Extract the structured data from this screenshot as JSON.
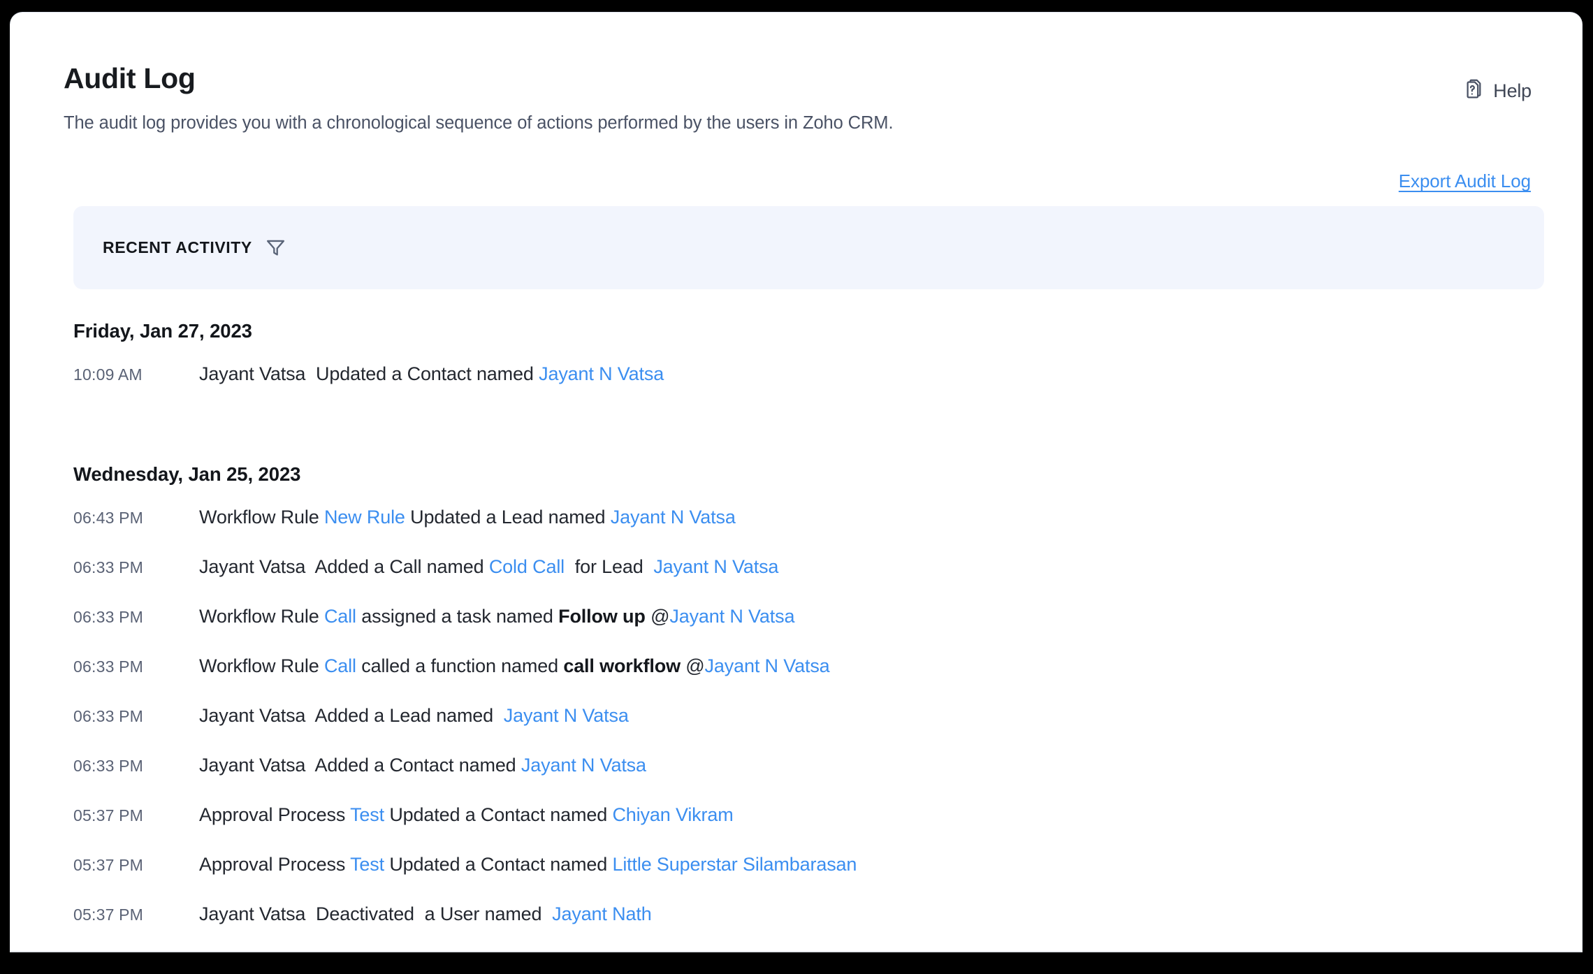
{
  "header": {
    "title": "Audit Log",
    "description": "The audit log provides you with a chronological sequence of actions performed by the users in Zoho CRM.",
    "help_label": "Help",
    "help_icon": "help-document-icon",
    "export_label": "Export Audit Log"
  },
  "toolbar": {
    "recent_activity_label": "RECENT ACTIVITY",
    "filter_icon": "filter-funnel-icon"
  },
  "colors": {
    "link": "#3b8ef0",
    "panel_background": "#f2f5fd",
    "text": "#23272f",
    "muted_text": "#5a6275"
  },
  "groups": [
    {
      "date": "Friday, Jan 27, 2023",
      "entries": [
        {
          "time": "10:09 AM",
          "parts": [
            {
              "t": "Jayant Vatsa  Updated a Contact named ",
              "s": "plain"
            },
            {
              "t": "Jayant N Vatsa",
              "s": "link"
            }
          ]
        }
      ]
    },
    {
      "date": "Wednesday, Jan 25, 2023",
      "entries": [
        {
          "time": "06:43 PM",
          "parts": [
            {
              "t": "Workflow Rule ",
              "s": "plain"
            },
            {
              "t": "New Rule",
              "s": "link"
            },
            {
              "t": " Updated a Lead named ",
              "s": "plain"
            },
            {
              "t": "Jayant N Vatsa",
              "s": "link"
            }
          ]
        },
        {
          "time": "06:33 PM",
          "parts": [
            {
              "t": "Jayant Vatsa  Added a Call named ",
              "s": "plain"
            },
            {
              "t": "Cold Call",
              "s": "link"
            },
            {
              "t": "  for Lead  ",
              "s": "plain"
            },
            {
              "t": "Jayant N Vatsa",
              "s": "link"
            }
          ]
        },
        {
          "time": "06:33 PM",
          "parts": [
            {
              "t": "Workflow Rule ",
              "s": "plain"
            },
            {
              "t": "Call",
              "s": "link"
            },
            {
              "t": " assigned a task named ",
              "s": "plain"
            },
            {
              "t": "Follow up",
              "s": "bold"
            },
            {
              "t": " @",
              "s": "plain"
            },
            {
              "t": "Jayant N Vatsa",
              "s": "link"
            }
          ]
        },
        {
          "time": "06:33 PM",
          "parts": [
            {
              "t": "Workflow Rule ",
              "s": "plain"
            },
            {
              "t": "Call",
              "s": "link"
            },
            {
              "t": " called a function named ",
              "s": "plain"
            },
            {
              "t": "call workflow",
              "s": "bold"
            },
            {
              "t": " @",
              "s": "plain"
            },
            {
              "t": "Jayant N Vatsa",
              "s": "link"
            }
          ]
        },
        {
          "time": "06:33 PM",
          "parts": [
            {
              "t": "Jayant Vatsa  Added a Lead named  ",
              "s": "plain"
            },
            {
              "t": "Jayant N Vatsa",
              "s": "link"
            }
          ]
        },
        {
          "time": "06:33 PM",
          "parts": [
            {
              "t": "Jayant Vatsa  Added a Contact named ",
              "s": "plain"
            },
            {
              "t": "Jayant N Vatsa",
              "s": "link"
            }
          ]
        },
        {
          "time": "05:37 PM",
          "parts": [
            {
              "t": "Approval Process ",
              "s": "plain"
            },
            {
              "t": "Test",
              "s": "link"
            },
            {
              "t": " Updated a Contact named ",
              "s": "plain"
            },
            {
              "t": "Chiyan Vikram",
              "s": "link"
            }
          ]
        },
        {
          "time": "05:37 PM",
          "parts": [
            {
              "t": "Approval Process ",
              "s": "plain"
            },
            {
              "t": "Test",
              "s": "link"
            },
            {
              "t": " Updated a Contact named ",
              "s": "plain"
            },
            {
              "t": "Little Superstar Silambarasan",
              "s": "link"
            }
          ]
        },
        {
          "time": "05:37 PM",
          "parts": [
            {
              "t": "Jayant Vatsa  Deactivated  a User named  ",
              "s": "plain"
            },
            {
              "t": "Jayant Nath",
              "s": "link"
            }
          ]
        }
      ]
    }
  ]
}
